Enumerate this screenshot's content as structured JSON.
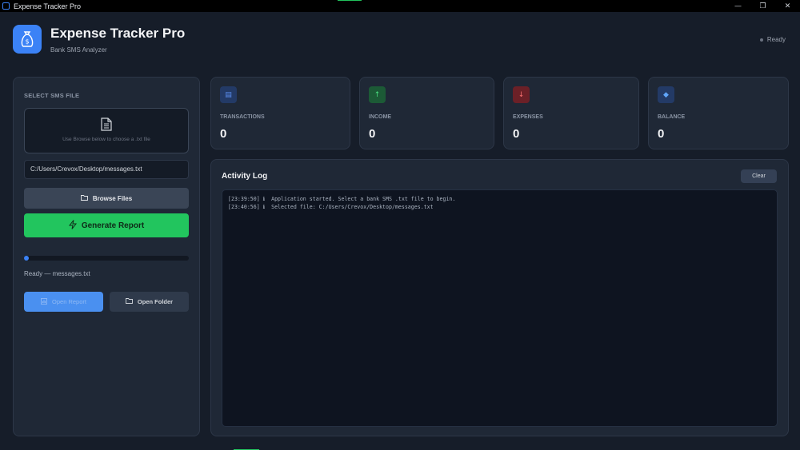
{
  "window": {
    "title": "Expense Tracker Pro",
    "controls": {
      "minimize": "—",
      "restore": "❐",
      "close": "✕"
    }
  },
  "header": {
    "title": "Expense Tracker Pro",
    "subtitle": "Bank SMS Analyzer",
    "status": "Ready",
    "logo_icon": "money-bag-icon"
  },
  "sidebar": {
    "section_label": "SELECT SMS FILE",
    "drop_hint": "Use Browse below to choose a .txt file",
    "file_path": "C:/Users/Crevox/Desktop/messages.txt",
    "browse_label": "Browse Files",
    "generate_label": "Generate Report",
    "progress_fraction": 0.02,
    "progress_text": "Ready — messages.txt",
    "open_report_label": "Open Report",
    "open_folder_label": "Open Folder"
  },
  "stats": [
    {
      "label": "TRANSACTIONS",
      "value": "0",
      "icon": "card-icon",
      "glyph": "▤",
      "bg": "#233a66",
      "fg": "#5b8ff0"
    },
    {
      "label": "INCOME",
      "value": "0",
      "icon": "arrow-up-icon",
      "glyph": "↑",
      "bg": "#1c5a36",
      "fg": "#4ade80"
    },
    {
      "label": "EXPENSES",
      "value": "0",
      "icon": "arrow-down-icon",
      "glyph": "↓",
      "bg": "#6b2027",
      "fg": "#f87171"
    },
    {
      "label": "BALANCE",
      "value": "0",
      "icon": "diamond-icon",
      "glyph": "◆",
      "bg": "#233a66",
      "fg": "#60a5fa"
    }
  ],
  "log": {
    "title": "Activity Log",
    "clear_label": "Clear",
    "lines": [
      "[23:39:50] ℹ  Application started. Select a bank SMS .txt file to begin.",
      "[23:40:56] ℹ  Selected file: C:/Users/Crevox/Desktop/messages.txt"
    ]
  },
  "colors": {
    "accent_blue": "#3b82f6",
    "accent_green": "#22c55e",
    "background": "#161d29",
    "panel": "#1f2836"
  }
}
